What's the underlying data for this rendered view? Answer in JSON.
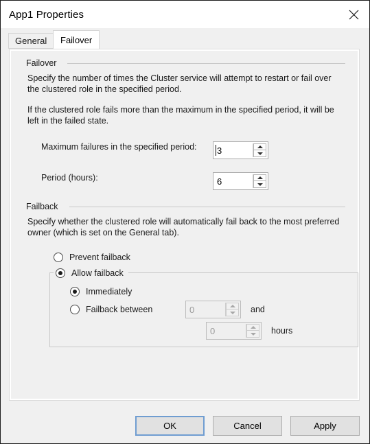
{
  "window": {
    "title": "App1 Properties",
    "close_icon": "close-icon"
  },
  "tabs": [
    {
      "label": "General",
      "active": false
    },
    {
      "label": "Failover",
      "active": true
    }
  ],
  "failover": {
    "group_label": "Failover",
    "paragraph1": "Specify the number of times the Cluster service will attempt to restart or fail over the clustered role in the specified period.",
    "paragraph2": "If the clustered role fails more than the maximum in the specified period, it will be left in the failed state.",
    "max_failures": {
      "label": "Maximum failures in the specified period:",
      "value": "3",
      "disabled": false,
      "focused": true
    },
    "period_hours": {
      "label": "Period (hours):",
      "value": "6",
      "disabled": false,
      "focused": false
    }
  },
  "failback": {
    "group_label": "Failback",
    "paragraph1": "Specify whether the clustered role will automatically fail back to the most preferred owner (which is set on the General tab).",
    "prevent": {
      "label": "Prevent failback",
      "selected": false
    },
    "allow": {
      "label": "Allow failback",
      "selected": true
    },
    "immediately": {
      "label": "Immediately",
      "selected": true
    },
    "between": {
      "label": "Failback between",
      "selected": false
    },
    "start_hour": {
      "value": "0",
      "disabled": true
    },
    "end_hour": {
      "value": "0",
      "disabled": true
    },
    "and_label": "and",
    "hours_label": "hours"
  },
  "buttons": {
    "ok": "OK",
    "cancel": "Cancel",
    "apply": "Apply"
  },
  "colors": {
    "accent_focus": "#6f9dd1",
    "dialog_face": "#f0f0f0",
    "titlebar": "#ffffff"
  }
}
